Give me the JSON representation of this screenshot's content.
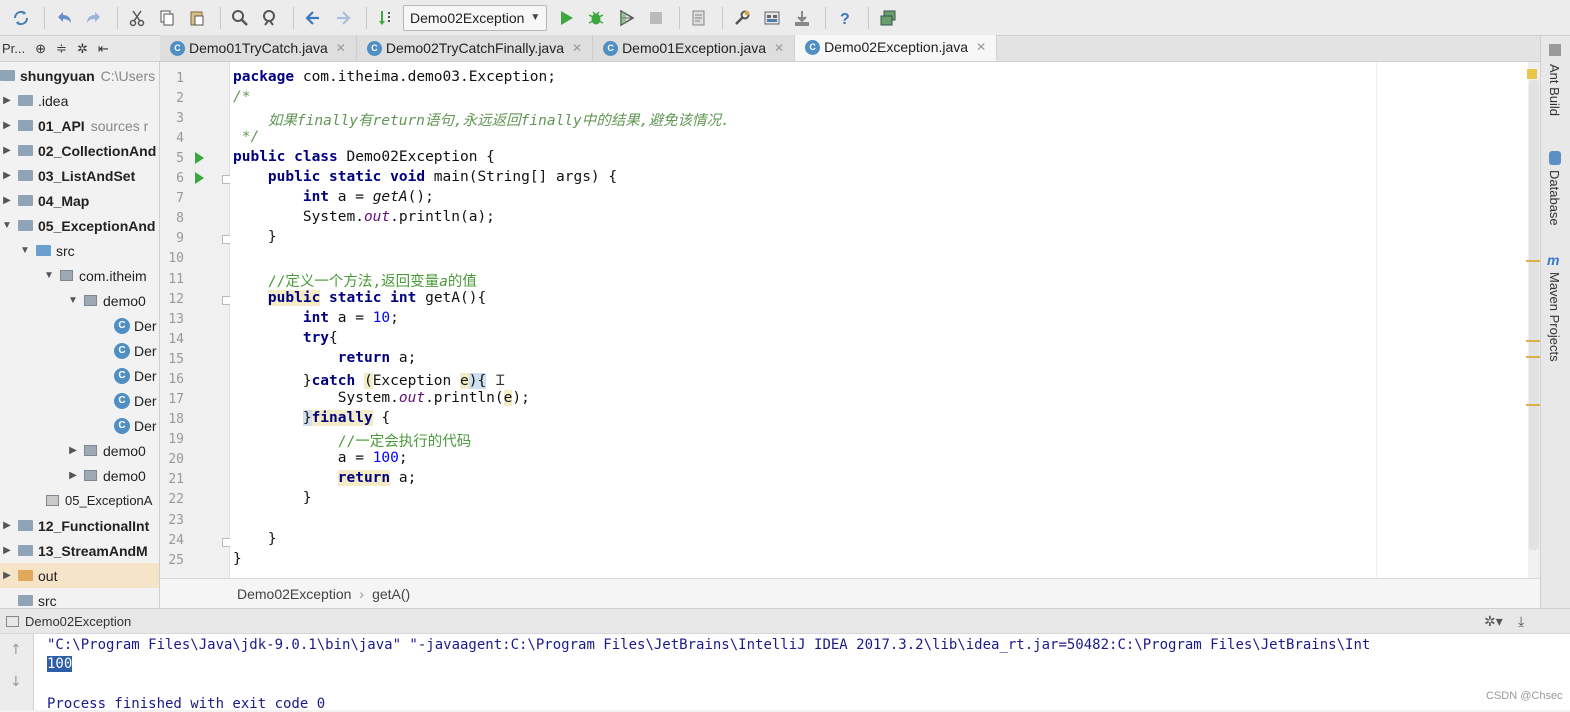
{
  "toolbar": {
    "run_config": "Demo02Exception",
    "buttons": [
      "sync-icon",
      "undo-icon",
      "redo-icon",
      "cut-icon",
      "copy-icon",
      "paste-icon",
      "find-icon",
      "replace-icon",
      "back-icon",
      "forward-icon",
      "build-icon",
      "run-icon",
      "debug-icon",
      "coverage-icon",
      "stop-icon",
      "project-structure-icon",
      "settings-icon",
      "sdk-icon",
      "vcs-icon",
      "help-icon",
      "terminal-icon"
    ]
  },
  "project_panel": {
    "header": "Pr...",
    "items": [
      {
        "label": "shungyuan",
        "extra": "C:\\Users",
        "bold": true
      },
      {
        "label": ".idea"
      },
      {
        "label": "01_API",
        "extra": "sources r",
        "bold": true
      },
      {
        "label": "02_CollectionAnd",
        "bold": true
      },
      {
        "label": "03_ListAndSet",
        "bold": true
      },
      {
        "label": "04_Map",
        "bold": true
      },
      {
        "label": "05_ExceptionAnd",
        "bold": true
      },
      {
        "label": "src"
      },
      {
        "label": "com.itheim"
      },
      {
        "label": "demo0"
      },
      {
        "label": "Der"
      },
      {
        "label": "Der"
      },
      {
        "label": "Der"
      },
      {
        "label": "Der"
      },
      {
        "label": "Der"
      },
      {
        "label": "demo0"
      },
      {
        "label": "demo0"
      },
      {
        "label": "05_ExceptionA"
      },
      {
        "label": "12_FunctionalInt",
        "bold": true
      },
      {
        "label": "13_StreamAndM",
        "bold": true
      },
      {
        "label": "out"
      },
      {
        "label": "src"
      }
    ]
  },
  "tabs": [
    {
      "label": "Demo01TryCatch.java"
    },
    {
      "label": "Demo02TryCatchFinally.java"
    },
    {
      "label": "Demo01Exception.java"
    },
    {
      "label": "Demo02Exception.java"
    }
  ],
  "editor": {
    "line_numbers": [
      "1",
      "2",
      "3",
      "4",
      "5",
      "6",
      "7",
      "8",
      "9",
      "10",
      "11",
      "12",
      "13",
      "14",
      "15",
      "16",
      "17",
      "18",
      "19",
      "20",
      "21",
      "22",
      "23",
      "24",
      "25"
    ]
  },
  "code": {
    "l1a": "package",
    "l1b": " com.itheima.demo03.Exception;",
    "l2": "/*",
    "l3a": "    如果",
    "l3b": "finally",
    "l3c": "有",
    "l3d": "return",
    "l3e": "语句,永远返回",
    "l3f": "finally",
    "l3g": "中的结果,避免该情况.",
    "l4": " */",
    "l5a": "public class",
    "l5b": " Demo02Exception {",
    "l6a": "    ",
    "l6b": "public static void",
    "l6c": " main(String[] args) {",
    "l7a": "        ",
    "l7b": "int",
    "l7c": " a = ",
    "l7d": "getA",
    "l7e": "();",
    "l8a": "        System.",
    "l8b": "out",
    "l8c": ".println(a);",
    "l9": "    }",
    "l11a": "    //定义一个方法,返回变量",
    "l11b": "a",
    "l11c": "的值",
    "l12a": "    ",
    "l12b": "public",
    "l12c": " ",
    "l12d": "static int",
    "l12e": " getA(){",
    "l13a": "        ",
    "l13b": "int",
    "l13c": " a = ",
    "l13d": "10",
    "l13e": ";",
    "l14a": "        ",
    "l14b": "try",
    "l14c": "{",
    "l15a": "            ",
    "l15b": "return",
    "l15c": " a;",
    "l16a": "        }",
    "l16b": "catch",
    "l16c": " ",
    "l16d": "(",
    "l16e": "Exception ",
    "l16f": "e",
    "l16g": "){",
    "l17a": "            System.",
    "l17b": "out",
    "l17c": ".println(",
    "l17d": "e",
    "l17e": ");",
    "l18a": "        ",
    "l18b": "}",
    "l18c": "finally",
    "l18d": " {",
    "l19": "            //一定会执行的代码",
    "l20a": "            a = ",
    "l20b": "100",
    "l20c": ";",
    "l21a": "            ",
    "l21b": "return",
    "l21c": " a;",
    "l22": "        }",
    "l24": "    }",
    "l25": "}"
  },
  "right_tools": {
    "ant": "Ant Build",
    "database": "Database",
    "maven": "Maven Projects"
  },
  "breadcrumb": {
    "class": "Demo02Exception",
    "method": "getA()"
  },
  "run_panel": {
    "title": "Demo02Exception",
    "line1": "\"C:\\Program Files\\Java\\jdk-9.0.1\\bin\\java\" \"-javaagent:C:\\Program Files\\JetBrains\\IntelliJ IDEA 2017.3.2\\lib\\idea_rt.jar=50482:C:\\Program Files\\JetBrains\\Int",
    "line2": "100",
    "line3": "Process finished with exit code 0"
  },
  "watermark": "CSDN @Chsec",
  "colors": {
    "keyword": "#000080",
    "comment": "#629755",
    "number": "#0000ff",
    "run_green": "#3ea63e"
  }
}
